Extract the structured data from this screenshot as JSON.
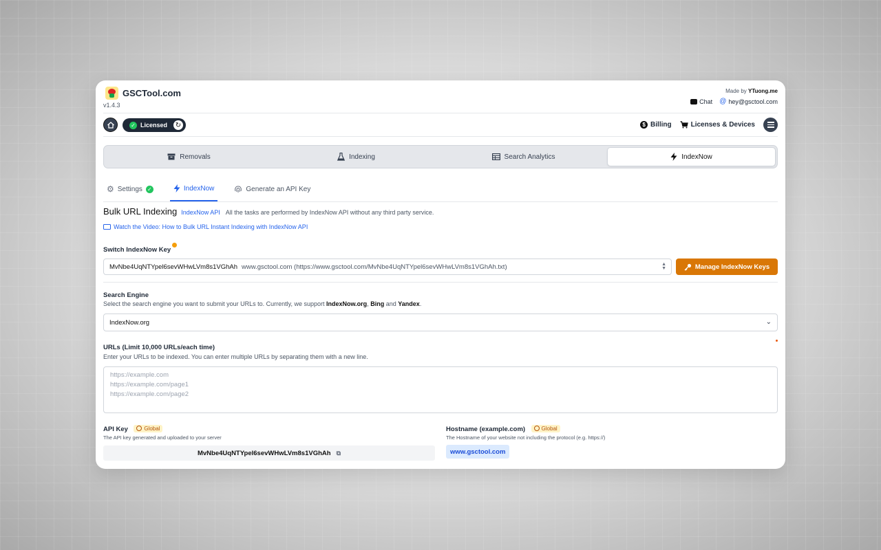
{
  "app": {
    "name": "GSCTool.com",
    "version": "v1.4.3",
    "made_by_prefix": "Made by",
    "made_by_name": "YTuong.me",
    "chat_label": "Chat",
    "email": "hey@gsctool.com"
  },
  "toolbar": {
    "licensed_label": "Licensed",
    "billing_label": "Billing",
    "licenses_label": "Licenses & Devices"
  },
  "main_tabs": [
    {
      "label": "Removals",
      "icon": "archive-icon"
    },
    {
      "label": "Indexing",
      "icon": "flask-icon"
    },
    {
      "label": "Search Analytics",
      "icon": "table-icon"
    },
    {
      "label": "IndexNow",
      "icon": "bolt-icon",
      "active": true
    }
  ],
  "sub_tabs": [
    {
      "label": "Settings",
      "icon": "gear-icon"
    },
    {
      "label": "IndexNow",
      "icon": "bolt-icon",
      "active": true
    },
    {
      "label": "Generate an API Key",
      "icon": "fingerprint-icon"
    }
  ],
  "bulk": {
    "title": "Bulk URL Indexing",
    "api_label": "IndexNow API",
    "description": "All the tasks are performed by IndexNow API without any third party service.",
    "video_link": "Watch the Video: How to Bulk URL Instant Indexing with IndexNow API"
  },
  "switch_key": {
    "label": "Switch IndexNow Key",
    "selected_key": "MvNbe4UqNTYpel6sevWHwLVm8s1VGhAh",
    "selected_detail": "www.gsctool.com (https://www.gsctool.com/MvNbe4UqNTYpel6sevWHwLVm8s1VGhAh.txt)",
    "manage_button": "Manage IndexNow Keys"
  },
  "search_engine": {
    "label": "Search Engine",
    "help_prefix": "Select the search engine you want to submit your URLs to. Currently, we support",
    "engine1": "IndexNow.org",
    "sep1": ",",
    "engine2": "Bing",
    "and": "and",
    "engine3": "Yandex",
    "end": ".",
    "selected": "IndexNow.org"
  },
  "urls": {
    "label": "URLs (Limit 10,000 URLs/each time)",
    "help": "Enter your URLs to be indexed. You can enter multiple URLs by separating them with a new line.",
    "placeholder_1": "https://example.com",
    "placeholder_2": "https://example.com/page1",
    "placeholder_3": "https://example.com/page2"
  },
  "api_key": {
    "label": "API Key",
    "badge": "Global",
    "help": "The API key generated and uploaded to your server",
    "value": "MvNbe4UqNTYpel6sevWHwLVm8s1VGhAh"
  },
  "hostname": {
    "label": "Hostname (example.com)",
    "badge": "Global",
    "help": "The Hostname of your website not including the protocol (e.g. https://)",
    "value": "www.gsctool.com"
  },
  "colors": {
    "accent": "#2563eb",
    "orange": "#d97706",
    "success": "#22c55e"
  }
}
